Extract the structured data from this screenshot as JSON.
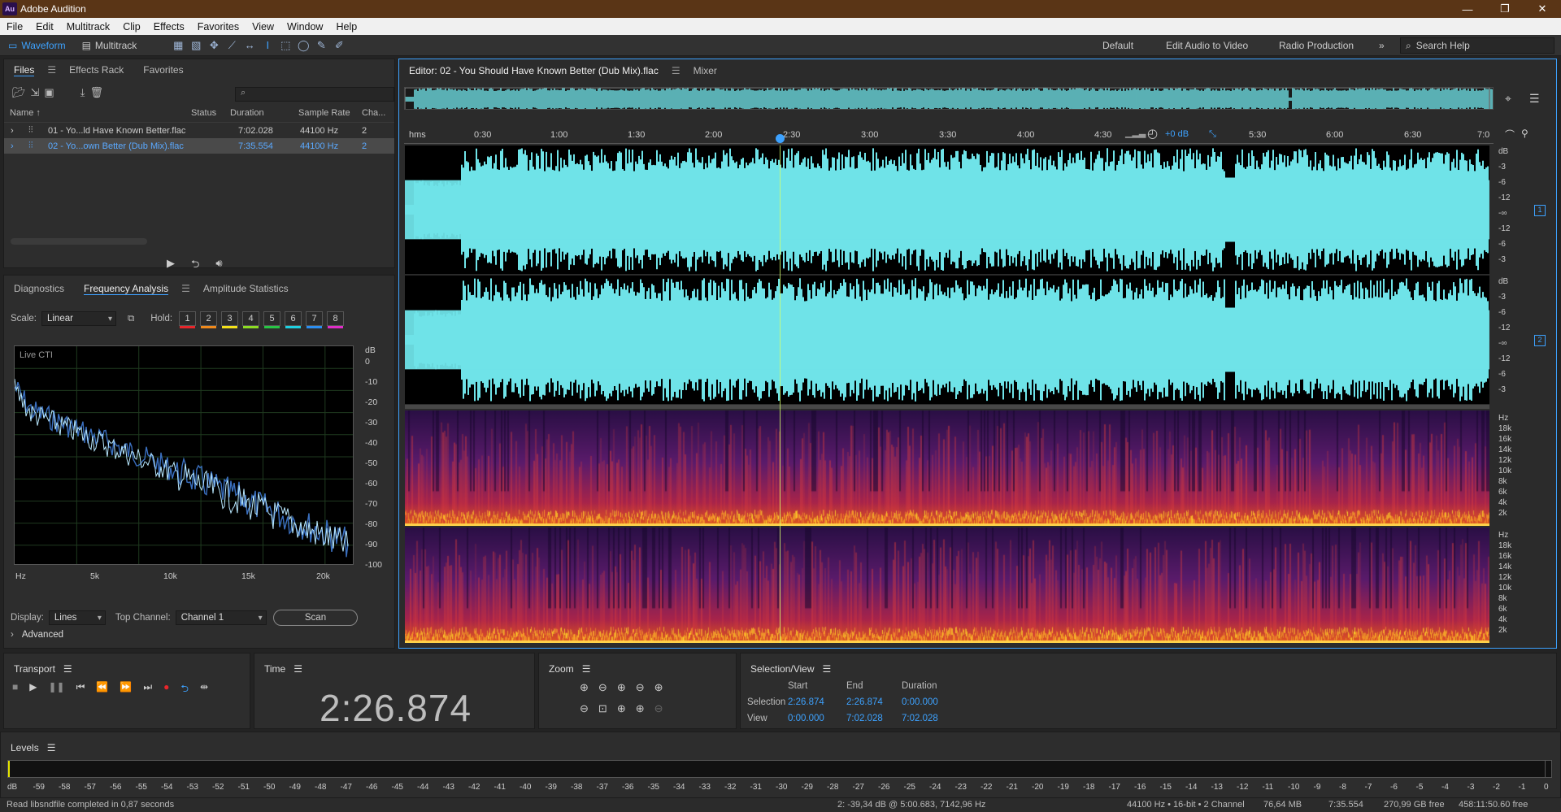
{
  "app": {
    "logo": "Au",
    "title": "Adobe Audition"
  },
  "window_buttons": [
    "—",
    "❐",
    "✕"
  ],
  "menu": [
    "File",
    "Edit",
    "Multitrack",
    "Clip",
    "Effects",
    "Favorites",
    "View",
    "Window",
    "Help"
  ],
  "toolbar": {
    "waveform_label": "Waveform",
    "multitrack_label": "Multitrack",
    "workspaces": [
      "Default",
      "Edit Audio to Video",
      "Radio Production"
    ],
    "more": "»",
    "search_placeholder": "Search Help"
  },
  "files_panel": {
    "tabs": [
      "Files",
      "Effects Rack",
      "Favorites"
    ],
    "search_icon": "⌕",
    "columns": {
      "name": "Name ↑",
      "status": "Status",
      "duration": "Duration",
      "sample_rate": "Sample Rate",
      "channels": "Cha..."
    },
    "rows": [
      {
        "name": "01 - Yo...ld Have Known Better.flac",
        "status": "",
        "duration": "7:02.028",
        "sample_rate": "44100 Hz",
        "channels": "2"
      },
      {
        "name": "02 - Yo...own Better (Dub Mix).flac",
        "status": "",
        "duration": "7:35.554",
        "sample_rate": "44100 Hz",
        "channels": "2"
      }
    ]
  },
  "analysis_panel": {
    "tabs": [
      "Diagnostics",
      "Frequency Analysis",
      "Amplitude Statistics"
    ],
    "scale_label": "Scale:",
    "scale_value": "Linear",
    "hold_label": "Hold:",
    "hold_buttons": [
      {
        "label": "1",
        "color": "#e8262b"
      },
      {
        "label": "2",
        "color": "#f08a1c"
      },
      {
        "label": "3",
        "color": "#f4e21a"
      },
      {
        "label": "4",
        "color": "#8ddc23"
      },
      {
        "label": "5",
        "color": "#28c545"
      },
      {
        "label": "6",
        "color": "#1fd0e0"
      },
      {
        "label": "7",
        "color": "#2c8ef0"
      },
      {
        "label": "8",
        "color": "#e02ec8"
      }
    ],
    "graph_label": "Live CTI",
    "db_unit": "dB",
    "db_ticks": [
      "0",
      "-10",
      "-20",
      "-30",
      "-40",
      "-50",
      "-60",
      "-70",
      "-80",
      "-90",
      "-100"
    ],
    "hz_ticks": [
      "Hz",
      "5k",
      "10k",
      "15k",
      "20k"
    ],
    "display_label": "Display:",
    "display_value": "Lines",
    "top_channel_label": "Top Channel:",
    "top_channel_value": "Channel 1",
    "scan_label": "Scan",
    "advanced_label": "Advanced"
  },
  "editor": {
    "tab_title": "Editor: 02 - You Should Have Known Better (Dub Mix).flac",
    "mixer_tab": "Mixer",
    "ruler_ticks": [
      "hms",
      "0:30",
      "1:00",
      "1:30",
      "2:00",
      "2:30",
      "3:00",
      "3:30",
      "4:00",
      "4:30",
      "5:30",
      "6:00",
      "6:30",
      "7:0"
    ],
    "gain": "+0 dB",
    "db_scale": [
      "dB",
      "-3",
      "-6",
      "-12",
      "-∞",
      "-12",
      "-6",
      "-3"
    ],
    "channel_labels": [
      "1",
      "2"
    ],
    "hz_scale": [
      "Hz",
      "18k",
      "16k",
      "14k",
      "12k",
      "10k",
      "8k",
      "6k",
      "4k",
      "2k"
    ],
    "playhead_time_s": 146.874,
    "total_duration_s": 455.554
  },
  "transport": {
    "title": "Transport"
  },
  "time_panel": {
    "title": "Time",
    "value": "2:26.874"
  },
  "zoom_panel": {
    "title": "Zoom"
  },
  "selection_view": {
    "title": "Selection/View",
    "headers": [
      "Start",
      "End",
      "Duration"
    ],
    "selection_label": "Selection",
    "selection": [
      "2:26.874",
      "2:26.874",
      "0:00.000"
    ],
    "view_label": "View",
    "view": [
      "0:00.000",
      "7:02.028",
      "7:02.028"
    ]
  },
  "levels": {
    "title": "Levels",
    "ticks": [
      "dB",
      "-59",
      "-58",
      "-57",
      "-56",
      "-55",
      "-54",
      "-53",
      "-52",
      "-51",
      "-50",
      "-49",
      "-48",
      "-47",
      "-46",
      "-45",
      "-44",
      "-43",
      "-42",
      "-41",
      "-40",
      "-39",
      "-38",
      "-37",
      "-36",
      "-35",
      "-34",
      "-33",
      "-32",
      "-31",
      "-30",
      "-29",
      "-28",
      "-27",
      "-26",
      "-25",
      "-24",
      "-23",
      "-22",
      "-21",
      "-20",
      "-19",
      "-18",
      "-17",
      "-16",
      "-15",
      "-14",
      "-13",
      "-12",
      "-11",
      "-10",
      "-9",
      "-8",
      "-7",
      "-6",
      "-5",
      "-4",
      "-3",
      "-2",
      "-1",
      "0"
    ]
  },
  "status": {
    "message": "Read libsndfile completed in 0,87 seconds",
    "cursor_info": "2: -39,34 dB @ 5:00.683, 7142,96 Hz",
    "format": "44100 Hz • 16-bit • 2 Channel",
    "size": "76,64 MB",
    "duration": "7:35.554",
    "free_space": "270,99 GB free",
    "free_time": "458:11:50.60 free"
  },
  "colors": {
    "accent": "#3da2ff",
    "waveform": "#6fe3e8",
    "title_bar": "#5a3516"
  }
}
